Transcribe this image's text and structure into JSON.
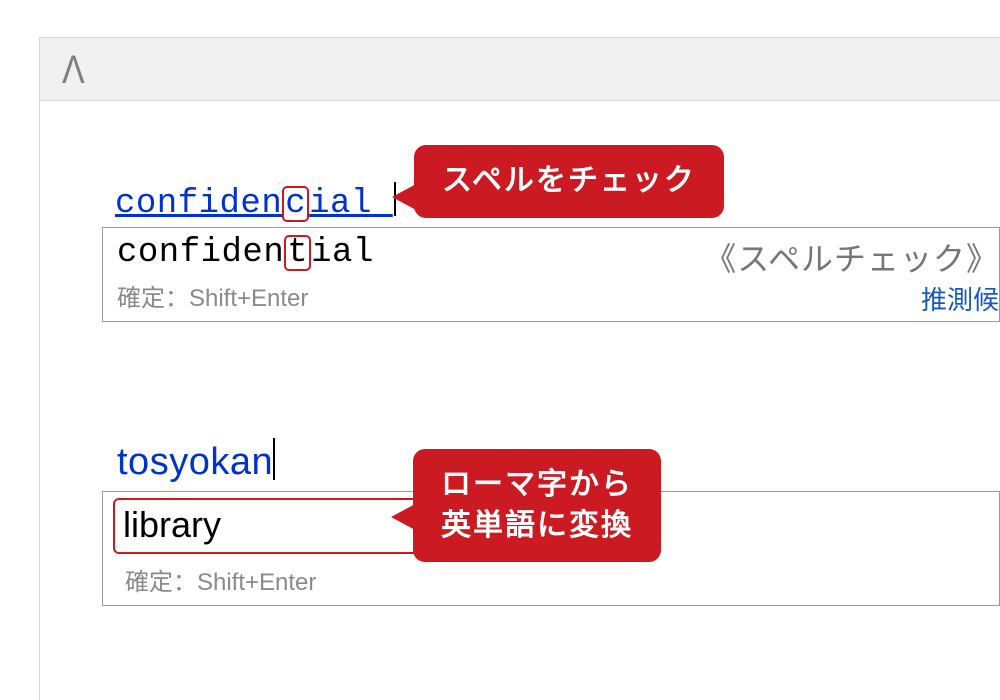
{
  "logo_text": "Λ",
  "group1": {
    "typed_before": "confiden",
    "typed_hl": "c",
    "typed_after": "ial",
    "candidate_before": "confiden",
    "candidate_hl": "t",
    "candidate_after": "ial",
    "tag": "《スペルチェック》",
    "hint": "確定：Shift+Enter",
    "link": "推測候",
    "callout": "スペルをチェック"
  },
  "group2": {
    "typed": "tosyokan",
    "candidate": "library",
    "bracket": "《",
    "hint": "確定：Shift+Enter",
    "callout_line1": "ローマ字から",
    "callout_line2": "英単語に変換"
  }
}
